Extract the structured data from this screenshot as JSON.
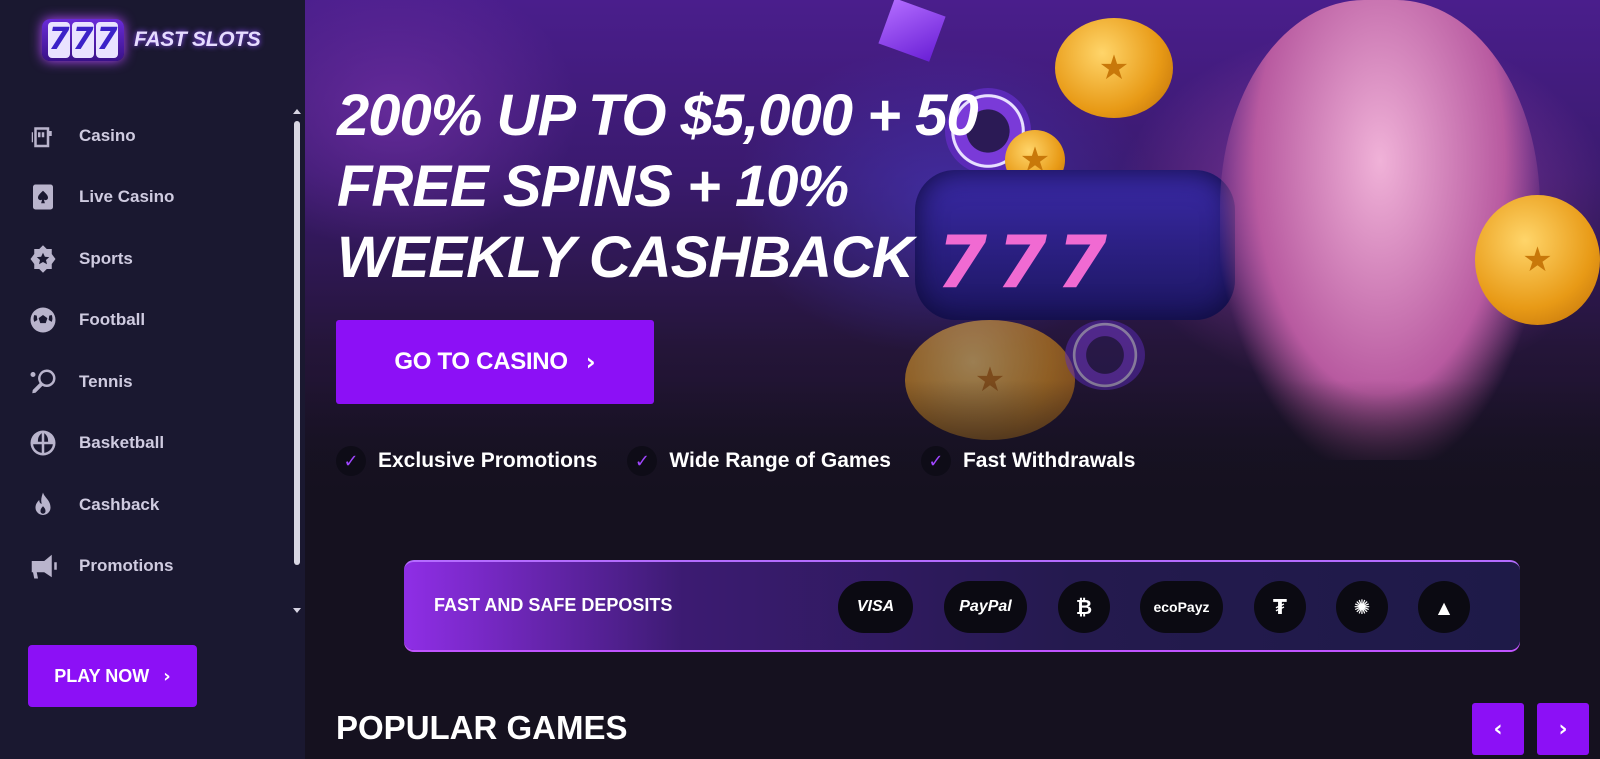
{
  "brand": {
    "logo_reels": [
      "7",
      "7",
      "7"
    ],
    "logo_text": "FAST SLOTS"
  },
  "sidebar": {
    "items": [
      {
        "label": "Casino",
        "icon": "slot-machine-icon"
      },
      {
        "label": "Live Casino",
        "icon": "spade-card-icon"
      },
      {
        "label": "Sports",
        "icon": "star-badge-icon"
      },
      {
        "label": "Football",
        "icon": "soccer-ball-icon"
      },
      {
        "label": "Tennis",
        "icon": "tennis-racket-icon"
      },
      {
        "label": "Basketball",
        "icon": "basketball-icon"
      },
      {
        "label": "Cashback",
        "icon": "flame-icon"
      },
      {
        "label": "Promotions",
        "icon": "megaphone-icon"
      }
    ],
    "play_now": "PLAY NOW"
  },
  "hero": {
    "title_lines": [
      "200% UP TO $5,000 + 50",
      "FREE SPINS + 10%",
      "WEEKLY CASHBACK"
    ],
    "cta": "GO TO CASINO",
    "features": [
      "Exclusive Promotions",
      "Wide Range of Games",
      "Fast Withdrawals"
    ]
  },
  "deposits": {
    "title": "FAST AND SAFE DEPOSITS",
    "methods": [
      {
        "label": "VISA",
        "icon": "visa-logo"
      },
      {
        "label": "PayPal",
        "icon": "paypal-logo"
      },
      {
        "label": "",
        "icon": "bitcoin-icon"
      },
      {
        "label": "ecoPayz",
        "icon": "ecopayz-logo"
      },
      {
        "label": "",
        "icon": "tether-icon"
      },
      {
        "label": "",
        "icon": "cardano-icon"
      },
      {
        "label": "",
        "icon": "arweave-icon"
      }
    ]
  },
  "games": {
    "title": "POPULAR GAMES"
  },
  "colors": {
    "accent": "#8c10f6",
    "sidebar_bg": "#1a1830",
    "main_bg": "#15111f"
  }
}
